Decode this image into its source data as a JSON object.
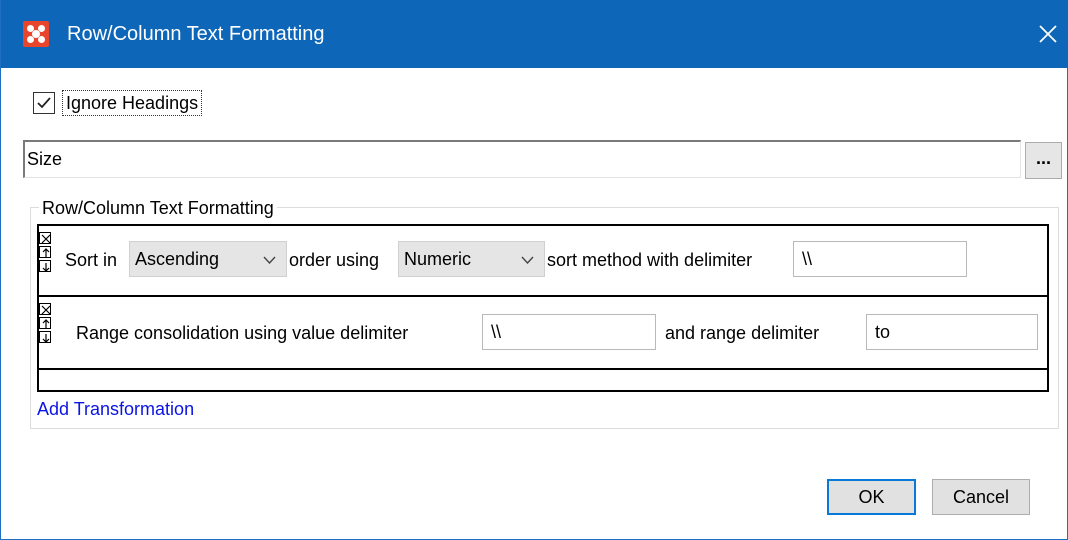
{
  "window": {
    "title": "Row/Column Text Formatting"
  },
  "ignore_headings": {
    "label": "Ignore Headings",
    "checked": true
  },
  "field": {
    "value": "Size",
    "browse_label": "..."
  },
  "group": {
    "title": "Row/Column Text Formatting"
  },
  "sort_transformation": {
    "prefix": "Sort in",
    "order_value": "Ascending",
    "middle": "order using",
    "method_value": "Numeric",
    "suffix": "sort method with delimiter",
    "delimiter_value": "\\\\"
  },
  "range_transformation": {
    "prefix": "Range consolidation using value delimiter",
    "value_delimiter": "\\\\",
    "middle": "and range delimiter",
    "range_delimiter": "to"
  },
  "add_transformation_label": "Add Transformation",
  "buttons": {
    "ok": "OK",
    "cancel": "Cancel"
  },
  "colors": {
    "titlebar": "#0d66b8",
    "app_icon": "#e8452c",
    "link": "#0a14e6",
    "ok_border": "#0a78d7"
  },
  "icons": {
    "app": "app-icon",
    "close": "close-icon",
    "check": "check-icon",
    "remove": "remove-icon",
    "move_up": "arrow-up-icon",
    "move_down": "arrow-down-icon",
    "dropdown": "chevron-down-icon"
  }
}
